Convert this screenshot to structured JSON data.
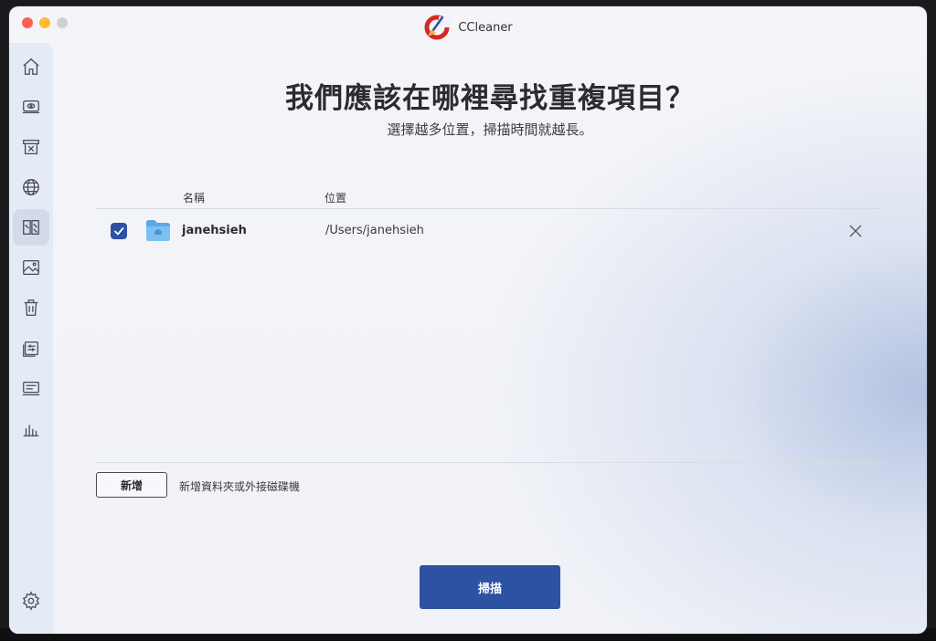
{
  "window": {
    "app_title": "CCleaner"
  },
  "sidebar": {
    "items": [
      {
        "name": "home-icon"
      },
      {
        "name": "health-check-icon"
      },
      {
        "name": "custom-clean-icon"
      },
      {
        "name": "browser-icon"
      },
      {
        "name": "duplicate-finder-icon",
        "active": true
      },
      {
        "name": "photo-icon"
      },
      {
        "name": "trash-icon"
      },
      {
        "name": "startup-icon"
      },
      {
        "name": "uninstall-icon"
      },
      {
        "name": "performance-icon"
      }
    ],
    "settings": {
      "name": "gear-icon"
    }
  },
  "main": {
    "heading": "我們應該在哪裡尋找重複項目？",
    "subheading": "選擇越多位置，掃描時間就越長。",
    "table": {
      "columns": {
        "name": "名稱",
        "location": "位置"
      },
      "rows": [
        {
          "checked": true,
          "name": "janehsieh",
          "location": "/Users/janehsieh"
        }
      ]
    },
    "add_button_label": "新增",
    "add_hint": "新增資料夾或外接磁碟機",
    "scan_button_label": "掃描"
  },
  "colors": {
    "accent": "#2d51a3",
    "sidebar_bg": "#e4eaf6"
  }
}
